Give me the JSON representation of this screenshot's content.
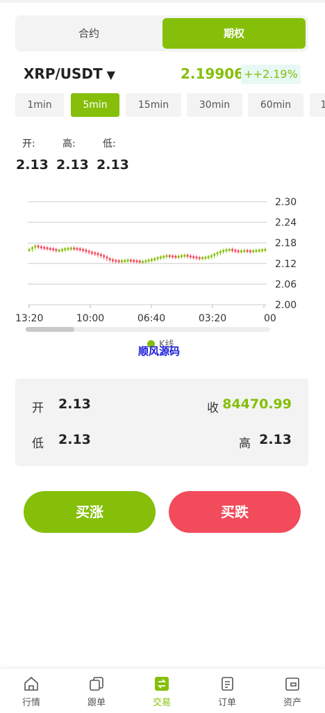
{
  "tabs": {
    "contract": "合约",
    "options": "期权"
  },
  "pair": {
    "symbol": "XRP/USDT",
    "caret": "▼",
    "price": "2.19906",
    "change": "++2.19%"
  },
  "intervals": [
    "1min",
    "5min",
    "15min",
    "30min",
    "60min",
    "1"
  ],
  "active_interval": "5min",
  "ohl": {
    "labels": [
      "开:",
      "高:",
      "低:"
    ],
    "values": [
      "2.13",
      "2.13",
      "2.13"
    ]
  },
  "chart_data": {
    "type": "candlestick",
    "ylim": [
      2.0,
      2.3
    ],
    "y_ticks": [
      "2.30",
      "2.24",
      "2.18",
      "2.12",
      "2.06",
      "2.00"
    ],
    "x_ticks": [
      "13:20",
      "10:00",
      "06:40",
      "03:20",
      "00"
    ],
    "series": [
      {
        "name": "K线",
        "values": [
          2.16,
          2.165,
          2.17,
          2.168,
          2.166,
          2.165,
          2.163,
          2.162,
          2.16,
          2.158,
          2.158,
          2.16,
          2.162,
          2.163,
          2.164,
          2.163,
          2.162,
          2.16,
          2.158,
          2.155,
          2.152,
          2.15,
          2.148,
          2.145,
          2.142,
          2.138,
          2.133,
          2.13,
          2.128,
          2.127,
          2.126,
          2.127,
          2.128,
          2.129,
          2.128,
          2.127,
          2.126,
          2.125,
          2.125,
          2.127,
          2.129,
          2.131,
          2.133,
          2.136,
          2.138,
          2.14,
          2.142,
          2.141,
          2.14,
          2.139,
          2.14,
          2.142,
          2.143,
          2.141,
          2.139,
          2.138,
          2.136,
          2.135,
          2.136,
          2.137,
          2.139,
          2.142,
          2.146,
          2.15,
          2.154,
          2.157,
          2.159,
          2.16,
          2.158,
          2.156,
          2.155,
          2.156,
          2.157,
          2.156,
          2.155,
          2.156,
          2.157,
          2.158,
          2.159,
          2.16
        ]
      }
    ]
  },
  "legend": "K线",
  "watermark": "顺风源码",
  "summary": {
    "open_label": "开",
    "open": "2.13",
    "close_label": "收",
    "close": "84470.99",
    "low_label": "低",
    "low": "2.13",
    "high_label": "高",
    "high": "2.13"
  },
  "buttons": {
    "buy": "买涨",
    "sell": "买跌"
  },
  "nav": [
    "行情",
    "跟单",
    "交易",
    "订单",
    "资产"
  ],
  "colors": {
    "accent": "#85bf09",
    "down": "#f24b5c"
  }
}
